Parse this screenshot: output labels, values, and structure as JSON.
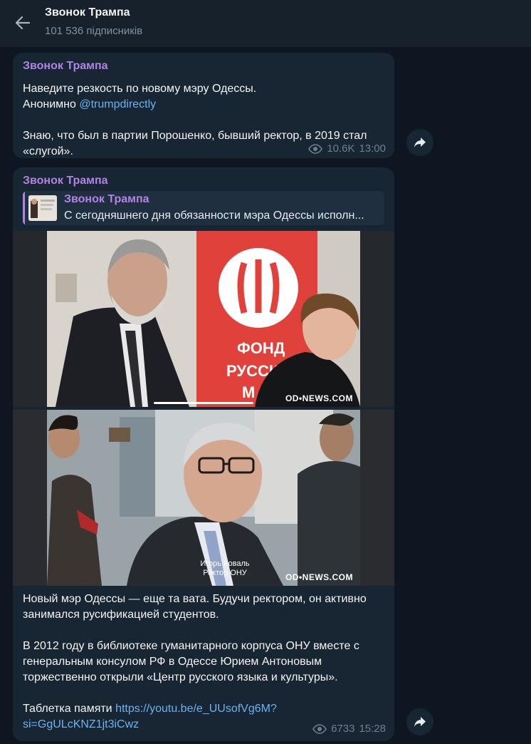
{
  "header": {
    "title": "Звонок Трампа",
    "subscribers": "101 536 підписників"
  },
  "messages": [
    {
      "author": "Звонок Трампа",
      "line1": "Наведите резкость по новому мэру Одессы.",
      "anon_prefix": "Анонимно ",
      "anon_link": "@trumpdirectly",
      "body": "Знаю, что был в партии Порошенко, бывший ректор, в 2019 стал\n«слугой».",
      "views": "10.6K",
      "time": "13:00"
    },
    {
      "author": "Звонок Трампа",
      "reply": {
        "author": "Звонок Трампа",
        "text": "С сегодняшнего дня обязанности мэра Одессы исполн..."
      },
      "photo1_watermark": "OD•NEWS.COM",
      "photo2_caption": "Игорь Коваль\nРектор ОНУ",
      "photo2_watermark": "OD•NEWS.COM",
      "body": "Новый мэр Одессы — еще та вата. Будучи ректором, он активно\nзанимался русификацией студентов.\n\nВ 2012 году в библиотеке гуманитарного корпуса ОНУ вместе с\nгенеральным консулом РФ в Одессе Юрием Антоновым\nторжественно открыли «Центр русского языка и культуры».",
      "link_prefix": "Таблетка памяти ",
      "link_line1": "https://youtu.be/e_UUsofVg6M?",
      "link_line2": "si=GgULcKNZ1jt3iCwz",
      "views": "6733",
      "time": "15:28"
    }
  ],
  "icons": {
    "back": "arrow-left-icon",
    "views": "eye-icon",
    "share": "share-arrow-icon"
  },
  "colors": {
    "accent_author": "#b283e6",
    "link": "#6ab3f3",
    "bubble": "#182533",
    "background": "#0e1621"
  }
}
